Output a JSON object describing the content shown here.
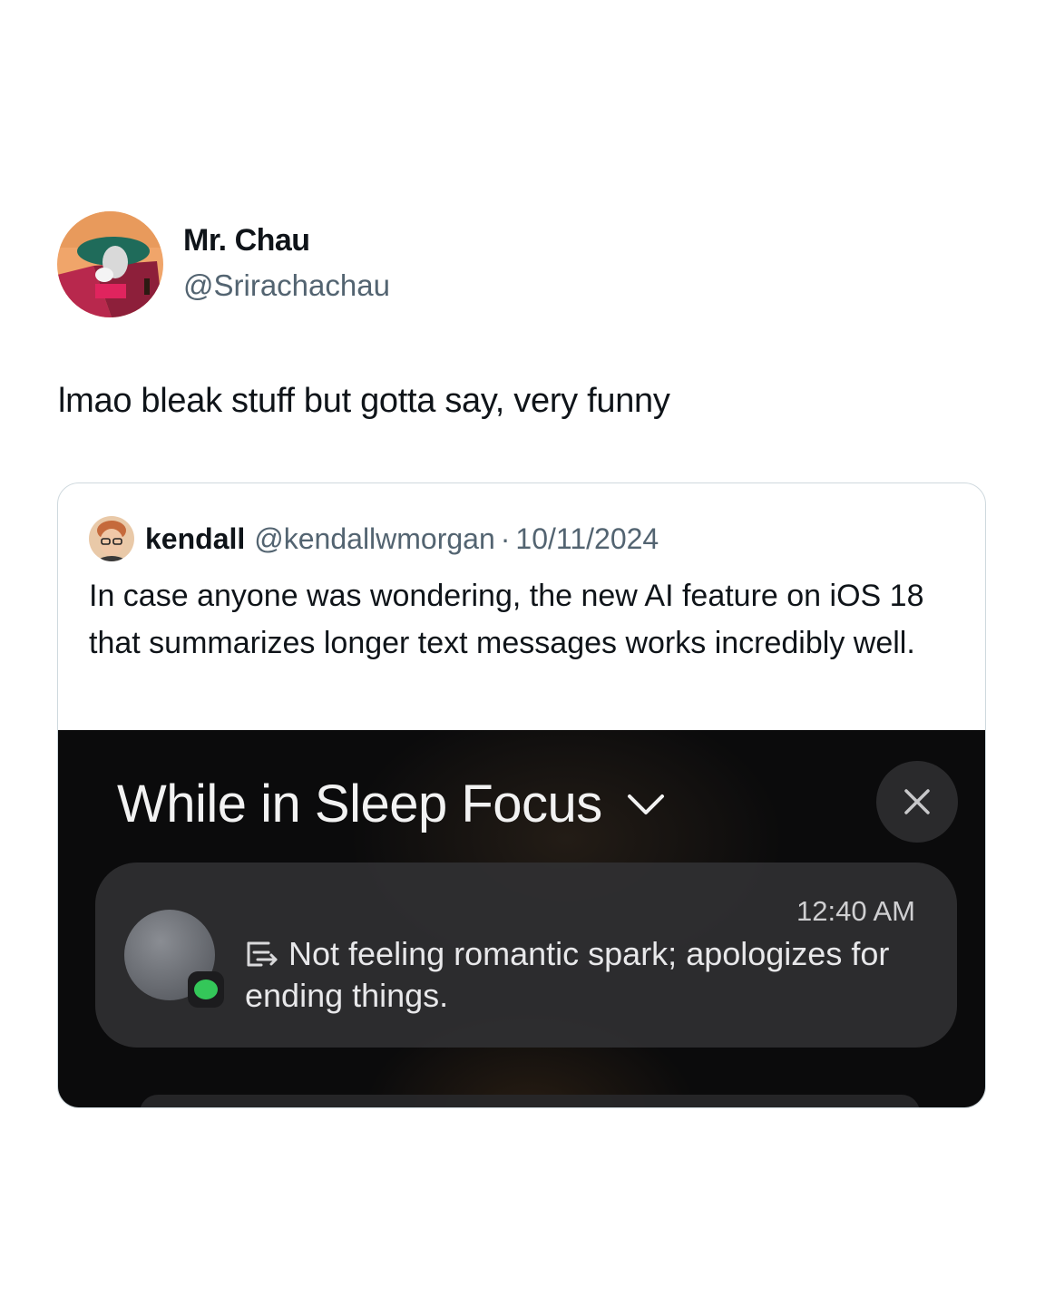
{
  "tweet": {
    "author": {
      "name": "Mr. Chau",
      "handle": "@Srirachachau"
    },
    "text": "lmao bleak stuff but gotta say, very funny"
  },
  "quoted_tweet": {
    "author": {
      "name": "kendall",
      "handle": "@kendallwmorgan"
    },
    "separator": "·",
    "date": "10/11/2024",
    "text": "In case anyone was wondering, the new AI feature on iOS 18 that summarizes longer text messages works incredibly well."
  },
  "ios_screenshot": {
    "focus_title": "While in Sleep Focus",
    "notification": {
      "time": "12:40 AM",
      "summary": "Not feeling romantic spark; apologizes for ending things.",
      "app_badge_icon": "messages-icon",
      "summary_icon": "summary-icon"
    }
  },
  "colors": {
    "text_primary": "#0f1419",
    "text_secondary": "#536471",
    "card_border": "#cfd9de",
    "ios_background": "#0b0b0c",
    "messages_green": "#34c759"
  }
}
